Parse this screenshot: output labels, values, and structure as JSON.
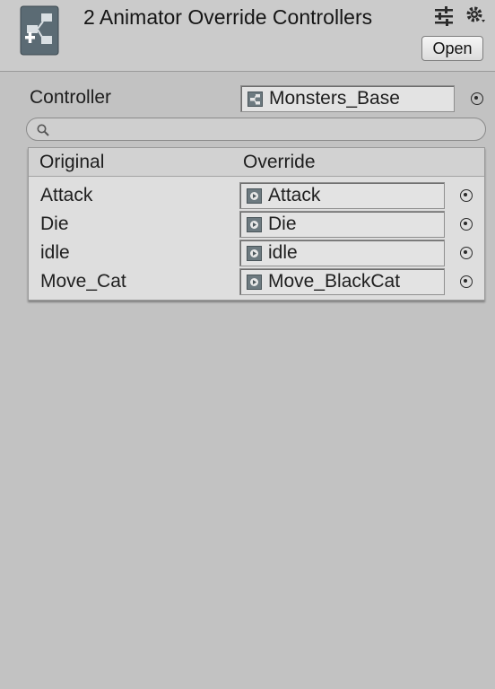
{
  "header": {
    "title": "2 Animator Override Controllers",
    "open_label": "Open",
    "icons": [
      "animator-override-controller-icon",
      "preset-sliders-icon",
      "gear-icon"
    ]
  },
  "controller": {
    "label": "Controller",
    "value": "Monsters_Base",
    "value_icon": "animator-controller-icon"
  },
  "search": {
    "placeholder": "",
    "icon": "search-icon"
  },
  "overrides": {
    "original_header": "Original",
    "override_header": "Override",
    "rows": [
      {
        "original": "Attack",
        "override": "Attack",
        "clip_icon": "animation-clip-icon"
      },
      {
        "original": "Die",
        "override": "Die",
        "clip_icon": "animation-clip-icon"
      },
      {
        "original": "idle",
        "override": "idle",
        "clip_icon": "animation-clip-icon"
      },
      {
        "original": "Move_Cat",
        "override": "Move_BlackCat",
        "clip_icon": "animation-clip-icon"
      }
    ]
  },
  "colors": {
    "window_bg": "#c2c2c2",
    "header_bg": "#cbcbcb",
    "field_bg": "#e3e3e3",
    "list_bg": "#dedede"
  }
}
